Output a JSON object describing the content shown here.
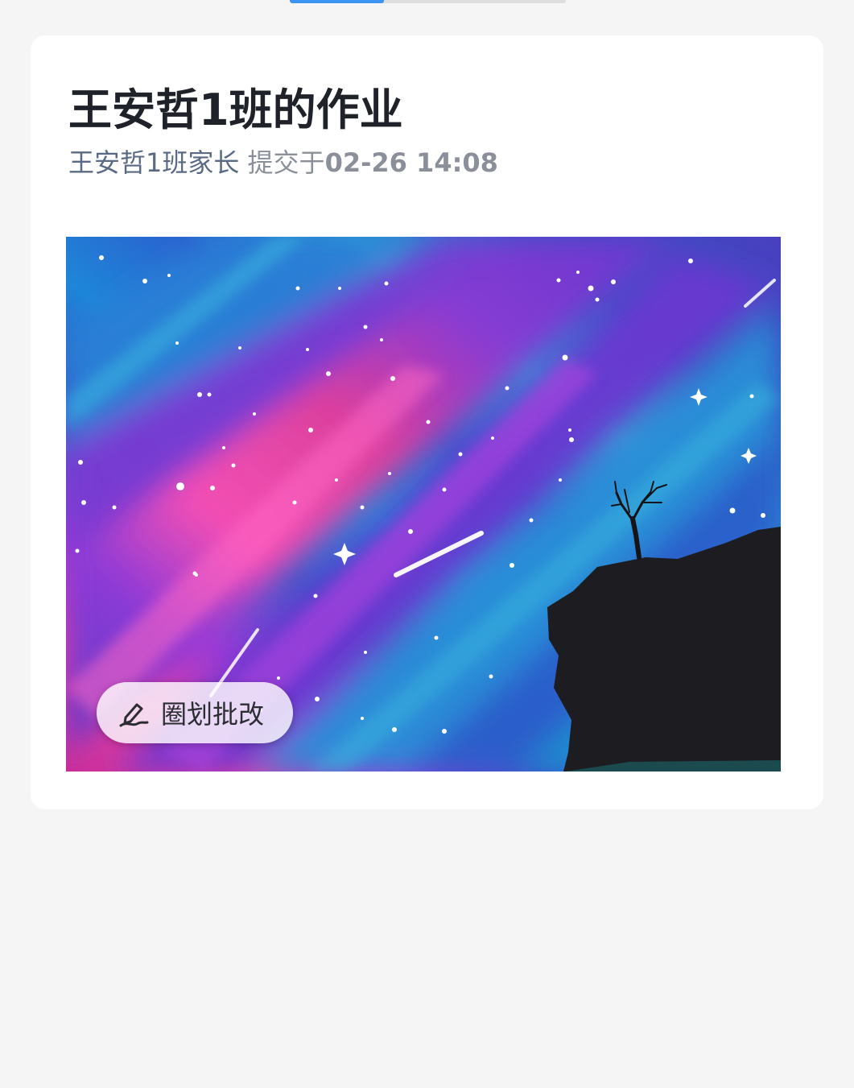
{
  "progress": {
    "value": 0.34
  },
  "homework": {
    "title": "王安哲1班的作业",
    "author": "王安哲1班家长",
    "submit_prefix": " 提交于",
    "submit_time": "02-26 14:08"
  },
  "artwork": {
    "subject": "watercolor night sky with milky way, shooting stars, cliff and tree silhouette"
  },
  "annotate_button": {
    "label": "圈划批改",
    "icon": "pen-icon"
  },
  "colors": {
    "accent": "#3d93f2",
    "background": "#f5f5f5",
    "title": "#1f2329",
    "author": "#5a6a85"
  }
}
